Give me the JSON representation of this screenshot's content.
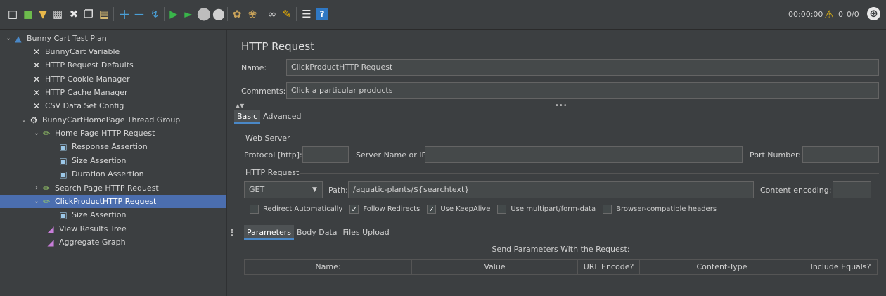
{
  "toolbar": {
    "icons": [
      "new-icon",
      "templates-icon",
      "open-icon",
      "save-icon",
      "cut-icon",
      "copy-icon",
      "paste-icon",
      "expand-icon",
      "collapse-icon",
      "toggle-icon",
      "start-icon",
      "start-no-pauses-icon",
      "stop-icon",
      "shutdown-icon",
      "clear-icon",
      "clear-all-icon",
      "search-icon",
      "reset-search-icon",
      "function-helper-icon",
      "help-icon"
    ],
    "timer": "00:00:00",
    "warning_count": "0",
    "threads": "0/0"
  },
  "tree": {
    "items": [
      {
        "label": "Bunny Cart Test Plan",
        "icon": "test-plan-icon"
      },
      {
        "label": "BunnyCart Variable",
        "icon": "config-icon"
      },
      {
        "label": "HTTP Request Defaults",
        "icon": "config-icon"
      },
      {
        "label": "HTTP Cookie Manager",
        "icon": "config-icon"
      },
      {
        "label": "HTTP Cache Manager",
        "icon": "config-icon"
      },
      {
        "label": "CSV Data Set Config",
        "icon": "config-icon"
      },
      {
        "label": "BunnyCartHomePage Thread Group",
        "icon": "thread-group-icon"
      },
      {
        "label": "Home Page HTTP Request",
        "icon": "sampler-icon"
      },
      {
        "label": "Response Assertion",
        "icon": "assertion-icon"
      },
      {
        "label": "Size Assertion",
        "icon": "assertion-icon"
      },
      {
        "label": "Duration Assertion",
        "icon": "assertion-icon"
      },
      {
        "label": "Search Page HTTP Request",
        "icon": "sampler-icon"
      },
      {
        "label": "ClickProductHTTP Request",
        "icon": "sampler-icon"
      },
      {
        "label": "Size Assertion",
        "icon": "assertion-icon"
      },
      {
        "label": "View Results Tree",
        "icon": "listener-icon"
      },
      {
        "label": "Aggregate Graph",
        "icon": "listener-icon"
      }
    ]
  },
  "panel": {
    "title": "HTTP Request",
    "name_label": "Name:",
    "name_value": "ClickProductHTTP Request",
    "comments_label": "Comments:",
    "comments_value": "Click a particular products",
    "tabs": [
      "Basic",
      "Advanced"
    ],
    "web_server": {
      "group_title": "Web Server",
      "protocol_label": "Protocol [http]:",
      "protocol_value": "",
      "server_label": "Server Name or IP:",
      "server_value": "",
      "port_label": "Port Number:",
      "port_value": ""
    },
    "http_request": {
      "group_title": "HTTP Request",
      "method": "GET",
      "path_label": "Path:",
      "path_value": "/aquatic-plants/${searchtext}",
      "encoding_label": "Content encoding:",
      "encoding_value": ""
    },
    "checkboxes": [
      {
        "label": "Redirect Automatically",
        "checked": false
      },
      {
        "label": "Follow Redirects",
        "checked": true
      },
      {
        "label": "Use KeepAlive",
        "checked": true
      },
      {
        "label": "Use multipart/form-data",
        "checked": false
      },
      {
        "label": "Browser-compatible headers",
        "checked": false
      }
    ],
    "subtabs": [
      "Parameters",
      "Body Data",
      "Files Upload"
    ],
    "params_caption": "Send Parameters With the Request:",
    "columns": [
      "Name:",
      "Value",
      "URL Encode?",
      "Content-Type",
      "Include Equals?"
    ]
  }
}
